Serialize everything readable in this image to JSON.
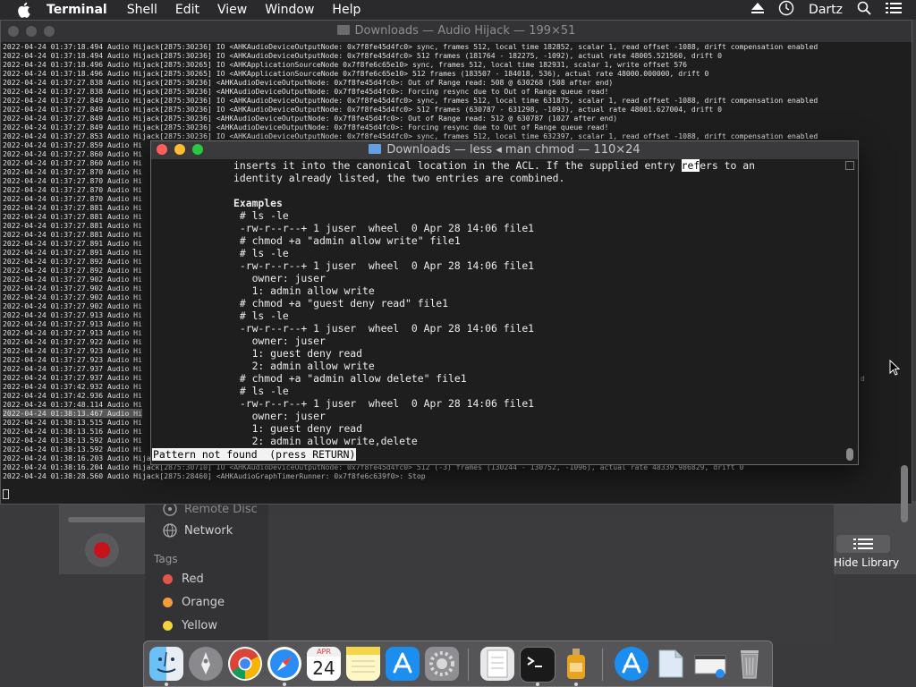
{
  "menubar": {
    "app_name": "Terminal",
    "items": [
      "Shell",
      "Edit",
      "View",
      "Window",
      "Help"
    ],
    "user": "Dartz",
    "icons": [
      "apple-icon",
      "eject-icon",
      "clock-icon",
      "spotlight-search-icon",
      "control-center-icon"
    ]
  },
  "back_window": {
    "title": "Downloads — Audio Hijack — 199×51",
    "lines": [
      "2022-04-24 01:37:18.494 Audio Hijack[2875:30236] IO <AHKAudioDeviceOutputNode: 0x7f8fe45d4fc0> sync, frames 512, local time 182852, scalar 1, read offset -1088, drift compensation enabled",
      "2022-04-24 01:37:18.494 Audio Hijack[2875:30236] IO <AHKAudioDeviceOutputNode: 0x7f8fe45d4fc0> 512 frames (181764 - 182275, -1092), actual rate 48005.521560, drift 0",
      "2022-04-24 01:37:18.496 Audio Hijack[2875:30265] IO <AHKApplicationSourceNode 0x7f8fe6c65e10> sync, frames 512, local time 182931, scalar 1, write offset 576",
      "2022-04-24 01:37:18.496 Audio Hijack[2875:30265] IO <AHKApplicationSourceNode 0x7f8fe6c65e10> 512 frames (183507 - 184018, 536), actual rate 48000.000000, drift 0",
      "2022-04-24 01:37:27.838 Audio Hijack[2875:30236] <AHKAudioDeviceOutputNode: 0x7f8fe45d4fc0>: Out of Range read: 508 @ 630268 (508 after end)",
      "2022-04-24 01:37:27.838 Audio Hijack[2875:30236] <AHKAudioDeviceOutputNode: 0x7f8fe45d4fc0>: Forcing resync due to Out of Range queue read!",
      "2022-04-24 01:37:27.849 Audio Hijack[2875:30236] IO <AHKAudioDeviceOutputNode: 0x7f8fe45d4fc0> sync, frames 512, local time 631875, scalar 1, read offset -1088, drift compensation enabled",
      "2022-04-24 01:37:27.849 Audio Hijack[2875:30236] IO <AHKAudioDeviceOutputNode: 0x7f8fe45d4fc0> 512 frames (630787 - 631298, -1093), actual rate 48001.627004, drift 0",
      "2022-04-24 01:37:27.849 Audio Hijack[2875:30236] <AHKAudioDeviceOutputNode: 0x7f8fe45d4fc0>: Out of Range read: 512 @ 630787 (1027 after end)",
      "2022-04-24 01:37:27.849 Audio Hijack[2875:30236] <AHKAudioDeviceOutputNode: 0x7f8fe45d4fc0>: Forcing resync due to Out of Range queue read!",
      "2022-04-24 01:37:27.853 Audio Hijack[2875:30236] IO <AHKAudioDeviceOutputNode: 0x7f8fe45d4fc0> sync, frames 512, local time 632397, scalar 1, read offset -1088, drift compensation enabled",
      "2022-04-24 01:37:27.859 Audio Hi",
      "2022-04-24 01:37:27.860 Audio Hi",
      "2022-04-24 01:37:27.860 Audio Hi",
      "2022-04-24 01:37:27.870 Audio Hi",
      "2022-04-24 01:37:27.870 Audio Hi",
      "2022-04-24 01:37:27.870 Audio Hi",
      "2022-04-24 01:37:27.870 Audio Hi",
      "2022-04-24 01:37:27.881 Audio Hi",
      "2022-04-24 01:37:27.881 Audio Hi",
      "2022-04-24 01:37:27.881 Audio Hi",
      "2022-04-24 01:37:27.881 Audio Hi",
      "2022-04-24 01:37:27.891 Audio Hi",
      "2022-04-24 01:37:27.891 Audio Hi",
      "2022-04-24 01:37:27.892 Audio Hi",
      "2022-04-24 01:37:27.892 Audio Hi",
      "2022-04-24 01:37:27.902 Audio Hi",
      "2022-04-24 01:37:27.902 Audio Hi",
      "2022-04-24 01:37:27.902 Audio Hi",
      "2022-04-24 01:37:27.902 Audio Hi",
      "2022-04-24 01:37:27.913 Audio Hi",
      "2022-04-24 01:37:27.913 Audio Hi",
      "2022-04-24 01:37:27.913 Audio Hi",
      "2022-04-24 01:37:27.922 Audio Hi",
      "2022-04-24 01:37:27.923 Audio Hi",
      "2022-04-24 01:37:27.923 Audio Hi",
      "2022-04-24 01:37:27.937 Audio Hi",
      "2022-04-24 01:37:27.937 Audio Hi",
      "2022-04-24 01:37:42.932 Audio Hi",
      "2022-04-24 01:37:42.936 Audio Hi",
      "2022-04-24 01:37:48.114 Audio Hi",
      "2022-04-24 01:38:13.467 Audio Hi",
      "2022-04-24 01:38:13.515 Audio Hi",
      "2022-04-24 01:38:13.516 Audio Hi",
      "2022-04-24 01:38:13.592 Audio Hi",
      "2022-04-24 01:38:13.592 Audio Hi",
      "2022-04-24 01:38:16.203 Audio Hijack[2875:30710] IO <AHKAudioDeviceOutputNode: 0x7f8fe45d4fc0> sync, frames 512, local time 131332, scalar 1, read offset -1088, drift compensation enabled",
      "2022-04-24 01:38:16.204 Audio Hijack[2875:30710] IO <AHKAudioDeviceOutputNode: 0x7f8fe45d4fc0> 512 (-3) frames (130244 - 130752, -1096), actual rate 48339.986829, drift 0",
      "2022-04-24 01:38:28.560 Audio Hijack[2875:28460] <AHKAudioGraphTimerRunner: 0x7f8fe6c639f0>: Stop"
    ],
    "side_fragment": "d"
  },
  "front_window": {
    "title": "Downloads — less ◂ man chmod — 110×24",
    "lines": [
      {
        "pre": "inserts it into the canonical location in the ACL. If the supplied entry ",
        "hl": "ref",
        "post": "ers to an"
      },
      {
        "text": "identity already listed, the two entries are combined."
      },
      {
        "text": ""
      },
      {
        "text": "Examples",
        "bold": true
      },
      {
        "text": " # ls -le"
      },
      {
        "text": " -rw-r--r--+ 1 juser  wheel  0 Apr 28 14:06 file1"
      },
      {
        "text": " # chmod +a \"admin allow write\" file1"
      },
      {
        "text": " # ls -le"
      },
      {
        "text": " -rw-r--r--+ 1 juser  wheel  0 Apr 28 14:06 file1"
      },
      {
        "text": "   owner: juser"
      },
      {
        "text": "   1: admin allow write"
      },
      {
        "text": " # chmod +a \"guest deny read\" file1"
      },
      {
        "text": " # ls -le"
      },
      {
        "text": " -rw-r--r--+ 1 juser  wheel  0 Apr 28 14:06 file1"
      },
      {
        "text": "   owner: juser"
      },
      {
        "text": "   1: guest deny read"
      },
      {
        "text": "   2: admin allow write"
      },
      {
        "text": " # chmod +a \"admin allow delete\" file1"
      },
      {
        "text": " # ls -le"
      },
      {
        "text": " -rw-r--r--+ 1 juser  wheel  0 Apr 28 14:06 file1"
      },
      {
        "text": "   owner: juser"
      },
      {
        "text": "   1: guest deny read"
      },
      {
        "text": "   2: admin allow write,delete"
      }
    ],
    "status": "Pattern not found  (press RETURN)"
  },
  "finder": {
    "sidebar": {
      "remote_disc": "Remote Disc",
      "network": "Network",
      "tags_header": "Tags",
      "tags": [
        {
          "label": "Red",
          "color": "#e5534b"
        },
        {
          "label": "Orange",
          "color": "#f29d38"
        },
        {
          "label": "Yellow",
          "color": "#f5d33b"
        }
      ]
    },
    "hide_library": "Hide Library"
  },
  "dock": {
    "calendar_month": "APR",
    "calendar_day": "24",
    "apps": [
      "finder-icon",
      "launchpad-icon",
      "chrome-icon",
      "safari-icon",
      "calendar-icon",
      "notes-icon",
      "app-store-icon",
      "system-preferences-icon",
      "script-editor-icon",
      "terminal-icon",
      "potion-app-icon",
      "app-store-icon-2",
      "documents-folder-icon",
      "screenshot-icon",
      "trash-icon"
    ]
  },
  "colors": {
    "terminal_bg": "#1e1e1e",
    "terminal_text": "#ececec",
    "menubar_bg": "#2a2a2c"
  }
}
